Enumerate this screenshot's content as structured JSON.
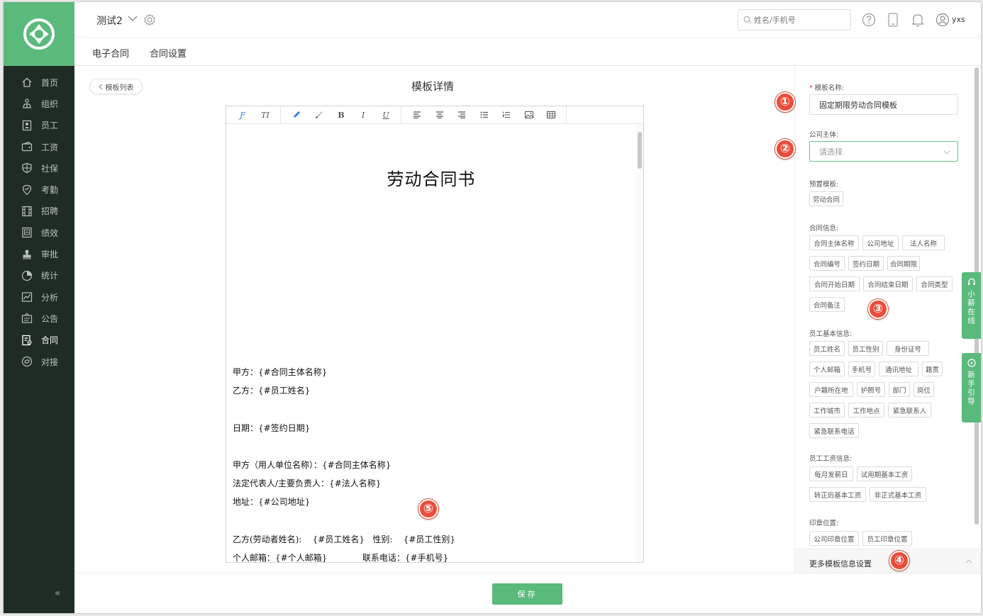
{
  "header": {
    "org_title": "测试2",
    "search_placeholder": "姓名/手机号",
    "user_name": "yxs"
  },
  "sidebar": {
    "items": [
      {
        "label": "首页",
        "icon": "home-icon"
      },
      {
        "label": "组织",
        "icon": "org-icon"
      },
      {
        "label": "员工",
        "icon": "employee-icon"
      },
      {
        "label": "工资",
        "icon": "wallet-icon"
      },
      {
        "label": "社保",
        "icon": "shield-icon"
      },
      {
        "label": "考勤",
        "icon": "location-icon"
      },
      {
        "label": "招聘",
        "icon": "film-icon"
      },
      {
        "label": "绩效",
        "icon": "performance-icon"
      },
      {
        "label": "审批",
        "icon": "stamp-icon"
      },
      {
        "label": "统计",
        "icon": "pie-icon"
      },
      {
        "label": "分析",
        "icon": "chart-icon"
      },
      {
        "label": "公告",
        "icon": "notice-icon"
      },
      {
        "label": "合同",
        "icon": "contract-icon"
      },
      {
        "label": "对接",
        "icon": "link-icon"
      }
    ],
    "active": "合同",
    "collapse_glyph": "«"
  },
  "subnav": {
    "tabs": [
      "电子合同",
      "合同设置"
    ]
  },
  "main": {
    "back_label": "模板列表",
    "page_title": "模板详情"
  },
  "editor": {
    "toolbar": [
      "font-icon",
      "text-size-icon",
      "pen-icon",
      "brush-icon",
      "bold-icon",
      "italic-icon",
      "underline-icon",
      "align-left-icon",
      "align-center-icon",
      "align-right-icon",
      "list-bullet-icon",
      "list-number-icon",
      "image-icon",
      "table-icon"
    ],
    "doc_title": "劳动合同书",
    "lines": [
      "甲方：{#合同主体名称}",
      "乙方：{#员工姓名}",
      "日期：{#签约日期}",
      "甲方（用人单位名称）：{#合同主体名称}",
      "法定代表人/主要负责人：{#法人名称}",
      "地址：{#公司地址}",
      "乙方(劳动者姓名):    {#员工姓名}   性别:    {#员工性别}",
      "个人邮箱：{#个人邮箱}             联系电话：{#手机号}"
    ]
  },
  "panel": {
    "template_name_label": "模板名称:",
    "template_name_value": "固定期限劳动合同模板",
    "company_label": "公司主体:",
    "company_placeholder": "请选择",
    "preset_label": "预置模板:",
    "preset_tags": [
      "劳动合同"
    ],
    "contract_info_label": "合同信息:",
    "contract_tags": [
      "合同主体名称",
      "公司地址",
      "法人名称",
      "合同编号",
      "签约日期",
      "合同期限",
      "合同开始日期",
      "合同结束日期",
      "合同类型",
      "合同备注"
    ],
    "employee_info_label": "员工基本信息:",
    "employee_tags": [
      "员工姓名",
      "员工性别",
      "身份证号",
      "个人邮箱",
      "手机号",
      "通讯地址",
      "籍贯",
      "户籍所在地",
      "护照号",
      "部门",
      "岗位",
      "工作城市",
      "工作地点",
      "紧急联系人",
      "紧急联系电话"
    ],
    "salary_info_label": "员工工资信息:",
    "salary_tags": [
      "每月发薪日",
      "试用期基本工资",
      "转正后基本工资",
      "非正式基本工资"
    ],
    "seal_label": "印章位置:",
    "seal_tags": [
      "公司印章位置",
      "员工印章位置"
    ],
    "more_label": "更多模板信息设置"
  },
  "footer": {
    "save_label": "保存"
  },
  "float_tabs": {
    "online": "小薪在线",
    "guide": "新手引导"
  },
  "callouts": [
    "①",
    "②",
    "③",
    "④",
    "⑤"
  ],
  "colors": {
    "brand": "#5aba7c",
    "sidebar_bg": "#1f2c24",
    "callout": "#e94d3a"
  }
}
